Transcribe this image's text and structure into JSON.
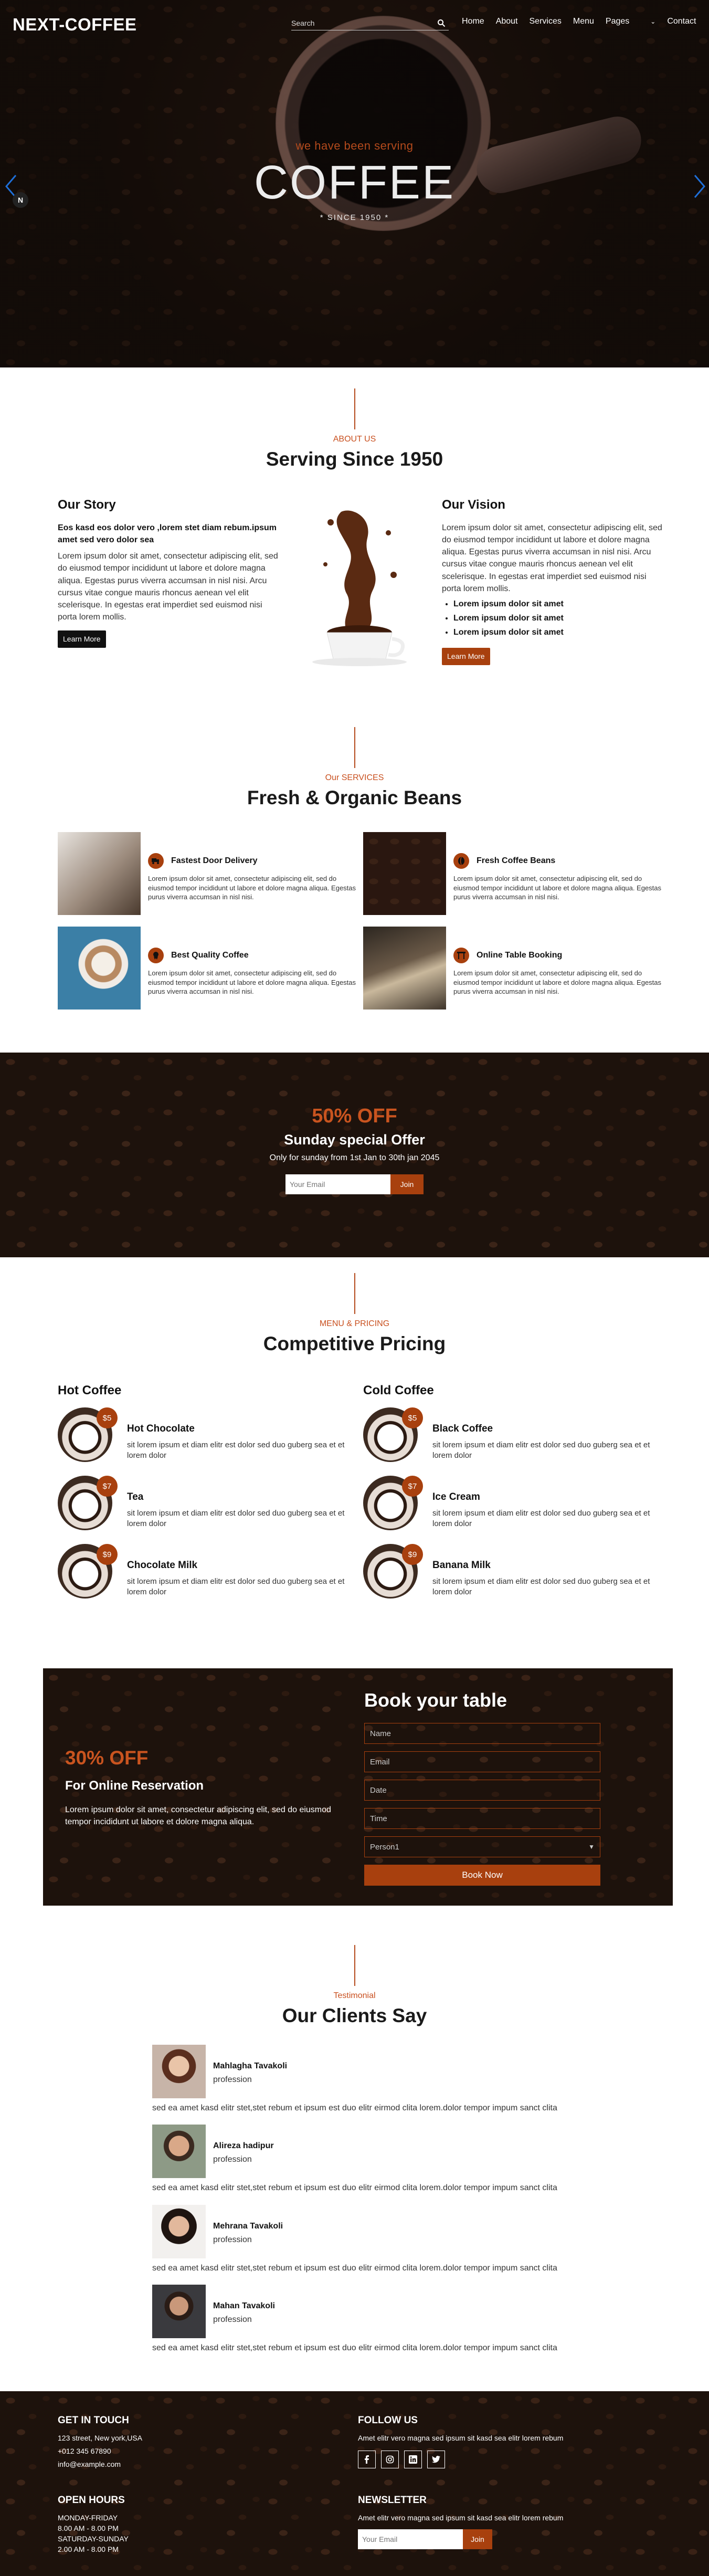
{
  "nav": {
    "logo": "NEXT-COFFEE",
    "search_placeholder": "Search",
    "links": [
      "Home",
      "About",
      "Services",
      "Menu",
      "Pages",
      "Contact"
    ]
  },
  "hero": {
    "subtitle": "we have been serving",
    "title": "COFFEE",
    "since": "* SINCE 1950 *",
    "pause_label": "N"
  },
  "about": {
    "eyebrow": "ABOUT US",
    "title": "Serving Since 1950",
    "story": {
      "heading": "Our Story",
      "lead": "Eos kasd eos dolor vero ,lorem stet diam rebum.ipsum amet sed vero dolor sea",
      "body": "Lorem ipsum dolor sit amet, consectetur adipiscing elit, sed do eiusmod tempor incididunt ut labore et dolore magna aliqua. Egestas purus viverra accumsan in nisl nisi. Arcu cursus vitae congue mauris rhoncus aenean vel elit scelerisque. In egestas erat imperdiet sed euismod nisi porta lorem mollis.",
      "button": "Learn More"
    },
    "vision": {
      "heading": "Our Vision",
      "body": "Lorem ipsum dolor sit amet, consectetur adipiscing elit, sed do eiusmod tempor incididunt ut labore et dolore magna aliqua. Egestas purus viverra accumsan in nisl nisi. Arcu cursus vitae congue mauris rhoncus aenean vel elit scelerisque. In egestas erat imperdiet sed euismod nisi porta lorem mollis.",
      "bullets": [
        "Lorem ipsum dolor sit amet",
        "Lorem ipsum dolor sit amet",
        "Lorem ipsum dolor sit amet"
      ],
      "button": "Learn More"
    }
  },
  "services": {
    "eyebrow": "Our SERVICES",
    "title": "Fresh & Organic Beans",
    "items": [
      {
        "title": "Fastest Door Delivery",
        "text": "Lorem ipsum dolor sit amet, consectetur adipiscing elit, sed do eiusmod tempor incididunt ut labore et dolore magna aliqua. Egestas purus viverra accumsan in nisl nisi.",
        "icon": "truck-icon"
      },
      {
        "title": "Fresh Coffee Beans",
        "text": "Lorem ipsum dolor sit amet, consectetur adipiscing elit, sed do eiusmod tempor incididunt ut labore et dolore magna aliqua. Egestas purus viverra accumsan in nisl nisi.",
        "icon": "bean-icon"
      },
      {
        "title": "Best Quality Coffee",
        "text": "Lorem ipsum dolor sit amet, consectetur adipiscing elit, sed do eiusmod tempor incididunt ut labore et dolore magna aliqua. Egestas purus viverra accumsan in nisl nisi.",
        "icon": "award-icon"
      },
      {
        "title": "Online Table Booking",
        "text": "Lorem ipsum dolor sit amet, consectetur adipiscing elit, sed do eiusmod tempor incididunt ut labore et dolore magna aliqua. Egestas purus viverra accumsan in nisl nisi.",
        "icon": "table-icon"
      }
    ]
  },
  "offer": {
    "percent": "50% OFF",
    "name": "Sunday special Offer",
    "note": "Only for sunday from 1st Jan to 30th jan 2045",
    "email_placeholder": "Your Email",
    "button": "Join"
  },
  "pricing": {
    "eyebrow": "MENU & PRICING",
    "title": "Competitive Pricing",
    "hot": {
      "heading": "Hot Coffee",
      "items": [
        {
          "name": "Hot Chocolate",
          "price": "$5",
          "desc": "sit lorem ipsum et diam elitr est dolor sed duo guberg sea et et lorem dolor"
        },
        {
          "name": "Tea",
          "price": "$7",
          "desc": "sit lorem ipsum et diam elitr est dolor sed duo guberg sea et et lorem dolor"
        },
        {
          "name": "Chocolate Milk",
          "price": "$9",
          "desc": "sit lorem ipsum et diam elitr est dolor sed duo guberg sea et et lorem dolor"
        }
      ]
    },
    "cold": {
      "heading": "Cold Coffee",
      "items": [
        {
          "name": "Black Coffee",
          "price": "$5",
          "desc": "sit lorem ipsum et diam elitr est dolor sed duo guberg sea et et lorem dolor"
        },
        {
          "name": "Ice Cream",
          "price": "$7",
          "desc": "sit lorem ipsum et diam elitr est dolor sed duo guberg sea et et lorem dolor"
        },
        {
          "name": "Banana Milk",
          "price": "$9",
          "desc": "sit lorem ipsum et diam elitr est dolor sed duo guberg sea et et lorem dolor"
        }
      ]
    }
  },
  "booking": {
    "percent": "30% OFF",
    "subtitle": "For Online Reservation",
    "text": "Lorem ipsum dolor sit amet, consectetur adipiscing elit, sed do eiusmod tempor incididunt ut labore et dolore magna aliqua.",
    "heading": "Book your table",
    "fields": {
      "name": "Name",
      "email": "Email",
      "date": "Date",
      "time": "Time",
      "person": "Person1"
    },
    "button": "Book Now"
  },
  "testimonials": {
    "eyebrow": "Testimonial",
    "title": "Our Clients Say",
    "items": [
      {
        "name": "Mahlagha Tavakoli",
        "role": "profession",
        "text": "sed ea amet kasd elitr stet,stet rebum et ipsum est duo elitr eirmod clita lorem.dolor tempor impum sanct clita"
      },
      {
        "name": "Alireza hadipur",
        "role": "profession",
        "text": "sed ea amet kasd elitr stet,stet rebum et ipsum est duo elitr eirmod clita lorem.dolor tempor impum sanct clita"
      },
      {
        "name": "Mehrana Tavakoli",
        "role": "profession",
        "text": "sed ea amet kasd elitr stet,stet rebum et ipsum est duo elitr eirmod clita lorem.dolor tempor impum sanct clita"
      },
      {
        "name": "Mahan Tavakoli",
        "role": "profession",
        "text": "sed ea amet kasd elitr stet,stet rebum et ipsum est duo elitr eirmod clita lorem.dolor tempor impum sanct clita"
      }
    ]
  },
  "footer": {
    "touch": {
      "heading": "GET IN TOUCH",
      "address": "123 street, New york,USA",
      "phone": "+012 345 67890",
      "email": "info@example.com"
    },
    "follow": {
      "heading": "FOLLOW US",
      "text": "Amet elitr vero magna sed ipsum sit kasd sea elitr lorem rebum"
    },
    "hours": {
      "heading": "OPEN HOURS",
      "l1": "MONDAY-FRIDAY",
      "l2": "8.00 AM - 8.00 PM",
      "l3": "SATURDAY-SUNDAY",
      "l4": "2.00 AM - 8.00 PM"
    },
    "newsletter": {
      "heading": "NEWSLETTER",
      "text": "Amet elitr vero magna sed ipsum sit kasd sea elitr lorem rebum",
      "email_placeholder": "Your Email",
      "button": "Join"
    }
  },
  "colors": {
    "accent": "#a8400e",
    "dark": "#1d120c"
  }
}
